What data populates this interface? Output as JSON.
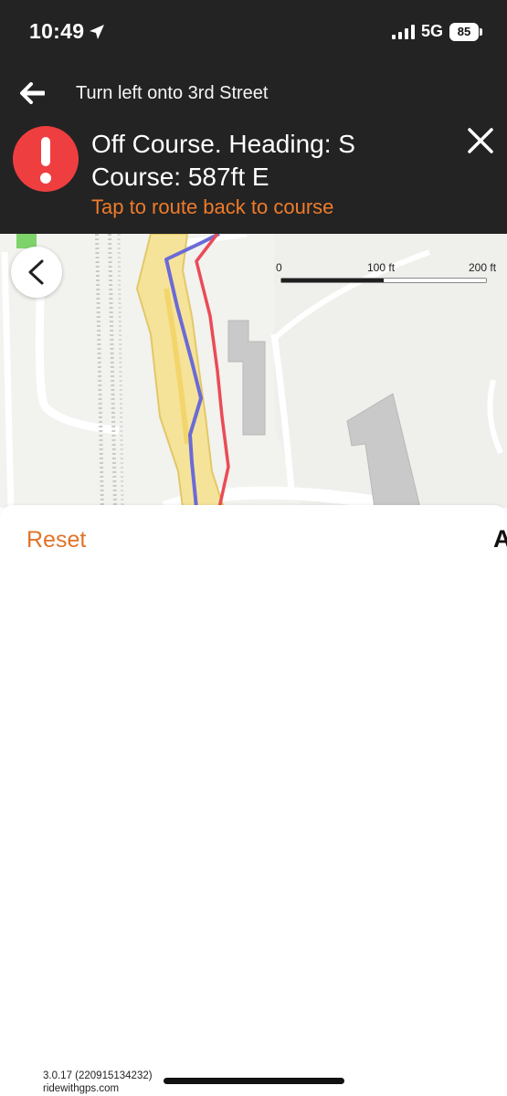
{
  "status_bar": {
    "time": "10:49",
    "network": "5G",
    "battery": "85",
    "icons": [
      "location-arrow-icon",
      "signal-bars-icon",
      "battery-icon"
    ]
  },
  "navigation": {
    "back_icon": "back-arrow-icon",
    "instruction": "Turn left onto 3rd Street"
  },
  "alert": {
    "icon": "exclamation-icon",
    "title": "Off Course. Heading: S",
    "subtitle": "Course: 587ft E",
    "action": "Tap to route back to course",
    "close_icon": "close-icon"
  },
  "map": {
    "back_icon": "chevron-left-icon",
    "scale": {
      "labels": [
        "0",
        "100 ft",
        "200 ft"
      ]
    },
    "colors": {
      "planned_route": "#6b6bd6",
      "actual_track": "#ea4b57",
      "path_highlight": "#f6e39a",
      "background": "#f2f2ef"
    }
  },
  "sheet": {
    "reset_label": "Reset",
    "edge_text": "A"
  },
  "footer": {
    "version": "3.0.17 (220915134232)",
    "domain": "ridewithgps.com"
  },
  "colors": {
    "header_bg": "#232323",
    "accent": "#e0742a",
    "alert_red": "#ef3e40"
  }
}
